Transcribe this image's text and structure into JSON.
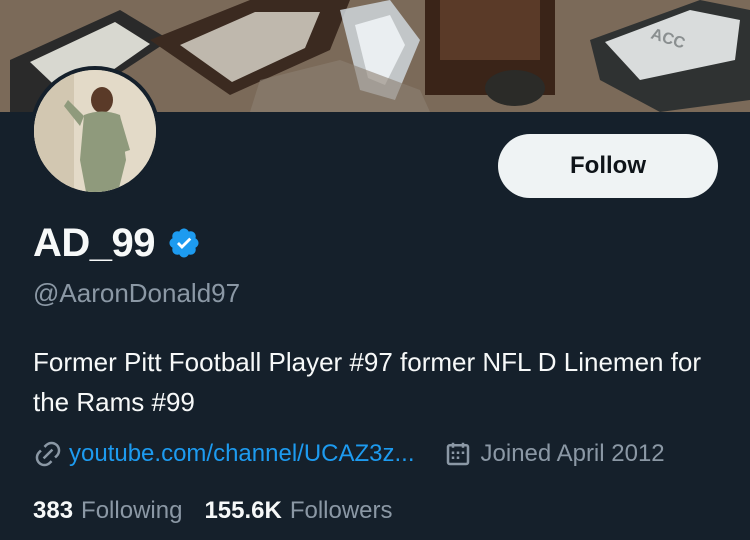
{
  "banner": {
    "description_icon": "banner-image"
  },
  "profile": {
    "display_name": "AD_99",
    "handle": "@AaronDonald97",
    "bio": "Former Pitt Football Player #97 former NFL D Linemen for the Rams #99",
    "verified_icon": "verified-badge-icon"
  },
  "actions": {
    "follow_label": "Follow"
  },
  "meta": {
    "link_icon": "link-icon",
    "link_text": "youtube.com/channel/UCAZ3z...",
    "calendar_icon": "calendar-icon",
    "joined_text": "Joined April 2012"
  },
  "stats": {
    "following_count": "383",
    "following_label": "Following",
    "followers_count": "155.6K",
    "followers_label": "Followers"
  },
  "colors": {
    "background": "#15202b",
    "accent": "#1d9bf0",
    "secondary_text": "#8b98a5",
    "button_bg": "#eff3f4"
  }
}
